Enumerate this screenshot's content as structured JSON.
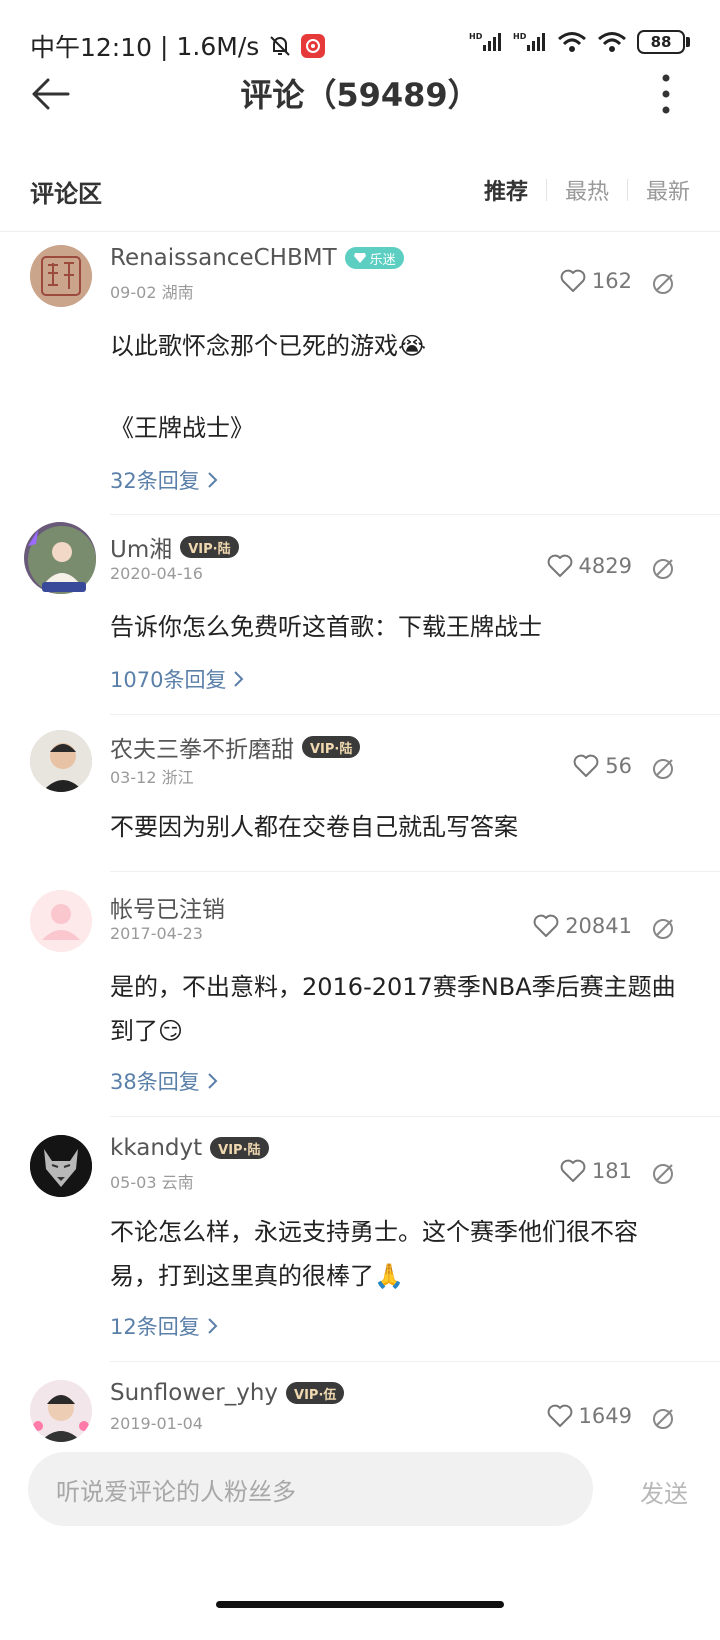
{
  "status_bar": {
    "time": "中午12:10",
    "speed": "1.6M/s",
    "battery": "88"
  },
  "header": {
    "title": "评论（59489）"
  },
  "section": {
    "title": "评论区",
    "tabs": [
      "推荐",
      "最热",
      "最新"
    ]
  },
  "comments": [
    {
      "username": "RenaissanceCHBMT",
      "badge": "乐迷",
      "meta": "09-02 湖南",
      "likes": "162",
      "text1": "以此歌怀念那个已死的游戏😭",
      "text2": "《王牌战士》",
      "replies": "32条回复"
    },
    {
      "username": "Um湘",
      "badge": "VIP·陆",
      "meta": "2020-04-16",
      "likes": "4829",
      "text1": "告诉你怎么免费听这首歌：下载王牌战士",
      "replies": "1070条回复"
    },
    {
      "username": "农夫三拳不折磨甜",
      "badge": "VIP·陆",
      "meta": "03-12 浙江",
      "likes": "56",
      "text1": "不要因为别人都在交卷自己就乱写答案"
    },
    {
      "username": "帐号已注销",
      "meta": "2017-04-23",
      "likes": "20841",
      "text1": "是的，不出意料，2016-2017赛季NBA季后赛主题曲",
      "text2": "到了😏",
      "replies": "38条回复"
    },
    {
      "username": "kkandyt",
      "badge": "VIP·陆",
      "meta": "05-03 云南",
      "likes": "181",
      "text1": "不论怎么样，永远支持勇士。这个赛季他们很不容",
      "text2": "易，打到这里真的很棒了🙏",
      "replies": "12条回复"
    },
    {
      "username": "Sunflower_yhy",
      "badge": "VIP·伍",
      "meta": "2019-01-04",
      "likes": "1649"
    }
  ],
  "input": {
    "placeholder": "听说爱评论的人粉丝多",
    "send_label": "发送"
  },
  "icons": {
    "back": "arrow-left-icon",
    "more": "more-vertical-icon",
    "like": "heart-icon",
    "dislike": "thumb-down-icon",
    "chevron": "chevron-right-icon"
  }
}
